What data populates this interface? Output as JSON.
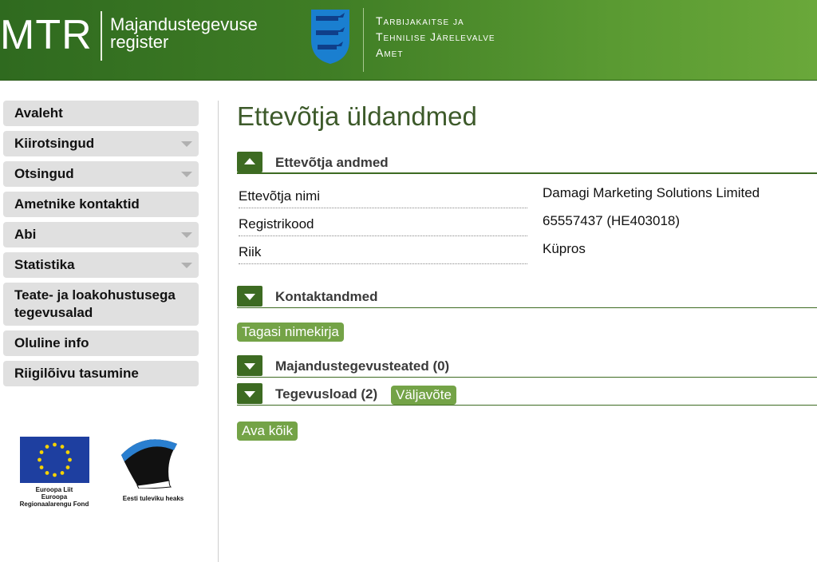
{
  "header": {
    "logo_short": "MTR",
    "logo_line1": "Majandustegevuse",
    "logo_line2": "register",
    "agency_line1": "Tarbijakaitse ja",
    "agency_line2": "Tehnilise Järelevalve",
    "agency_line3": "Amet"
  },
  "sidebar": {
    "items": [
      {
        "label": "Avaleht",
        "has_arrow": false
      },
      {
        "label": "Kiirotsingud",
        "has_arrow": true
      },
      {
        "label": "Otsingud",
        "has_arrow": true
      },
      {
        "label": "Ametnike kontaktid",
        "has_arrow": false
      },
      {
        "label": "Abi",
        "has_arrow": true
      },
      {
        "label": "Statistika",
        "has_arrow": true
      },
      {
        "label": "Teate- ja loakohustusega tegevusalad",
        "has_arrow": false
      },
      {
        "label": "Oluline info",
        "has_arrow": false
      },
      {
        "label": "Riigilõivu tasumine",
        "has_arrow": false
      }
    ],
    "eu_caption_line1": "Euroopa Liit",
    "eu_caption_line2": "Euroopa",
    "eu_caption_line3": "Regionaalarengu Fond",
    "est_caption": "Eesti tuleviku heaks"
  },
  "main": {
    "page_title": "Ettevõtja üldandmed",
    "company_section": {
      "title": "Ettevõtja andmed",
      "rows": [
        {
          "label": "Ettevõtja nimi",
          "value": "Damagi Marketing Solutions Limited"
        },
        {
          "label": "Registrikood",
          "value": "65557437 (HE403018)"
        },
        {
          "label": "Riik",
          "value": "Küpros"
        }
      ]
    },
    "contact_section": {
      "title": "Kontaktandmed"
    },
    "back_button": "Tagasi nimekirja",
    "notices_section": {
      "title": "Majandustegevusteated (0)"
    },
    "licenses_section": {
      "title": "Tegevusload (2)",
      "extract_button": "Väljavõte"
    },
    "open_all_button": "Ava kõik"
  },
  "colors": {
    "header_dark": "#2f6a1f",
    "header_light": "#6aa83a",
    "accent_green": "#3d6b22",
    "button_green": "#74a347",
    "title_green": "#3d5a2a"
  }
}
